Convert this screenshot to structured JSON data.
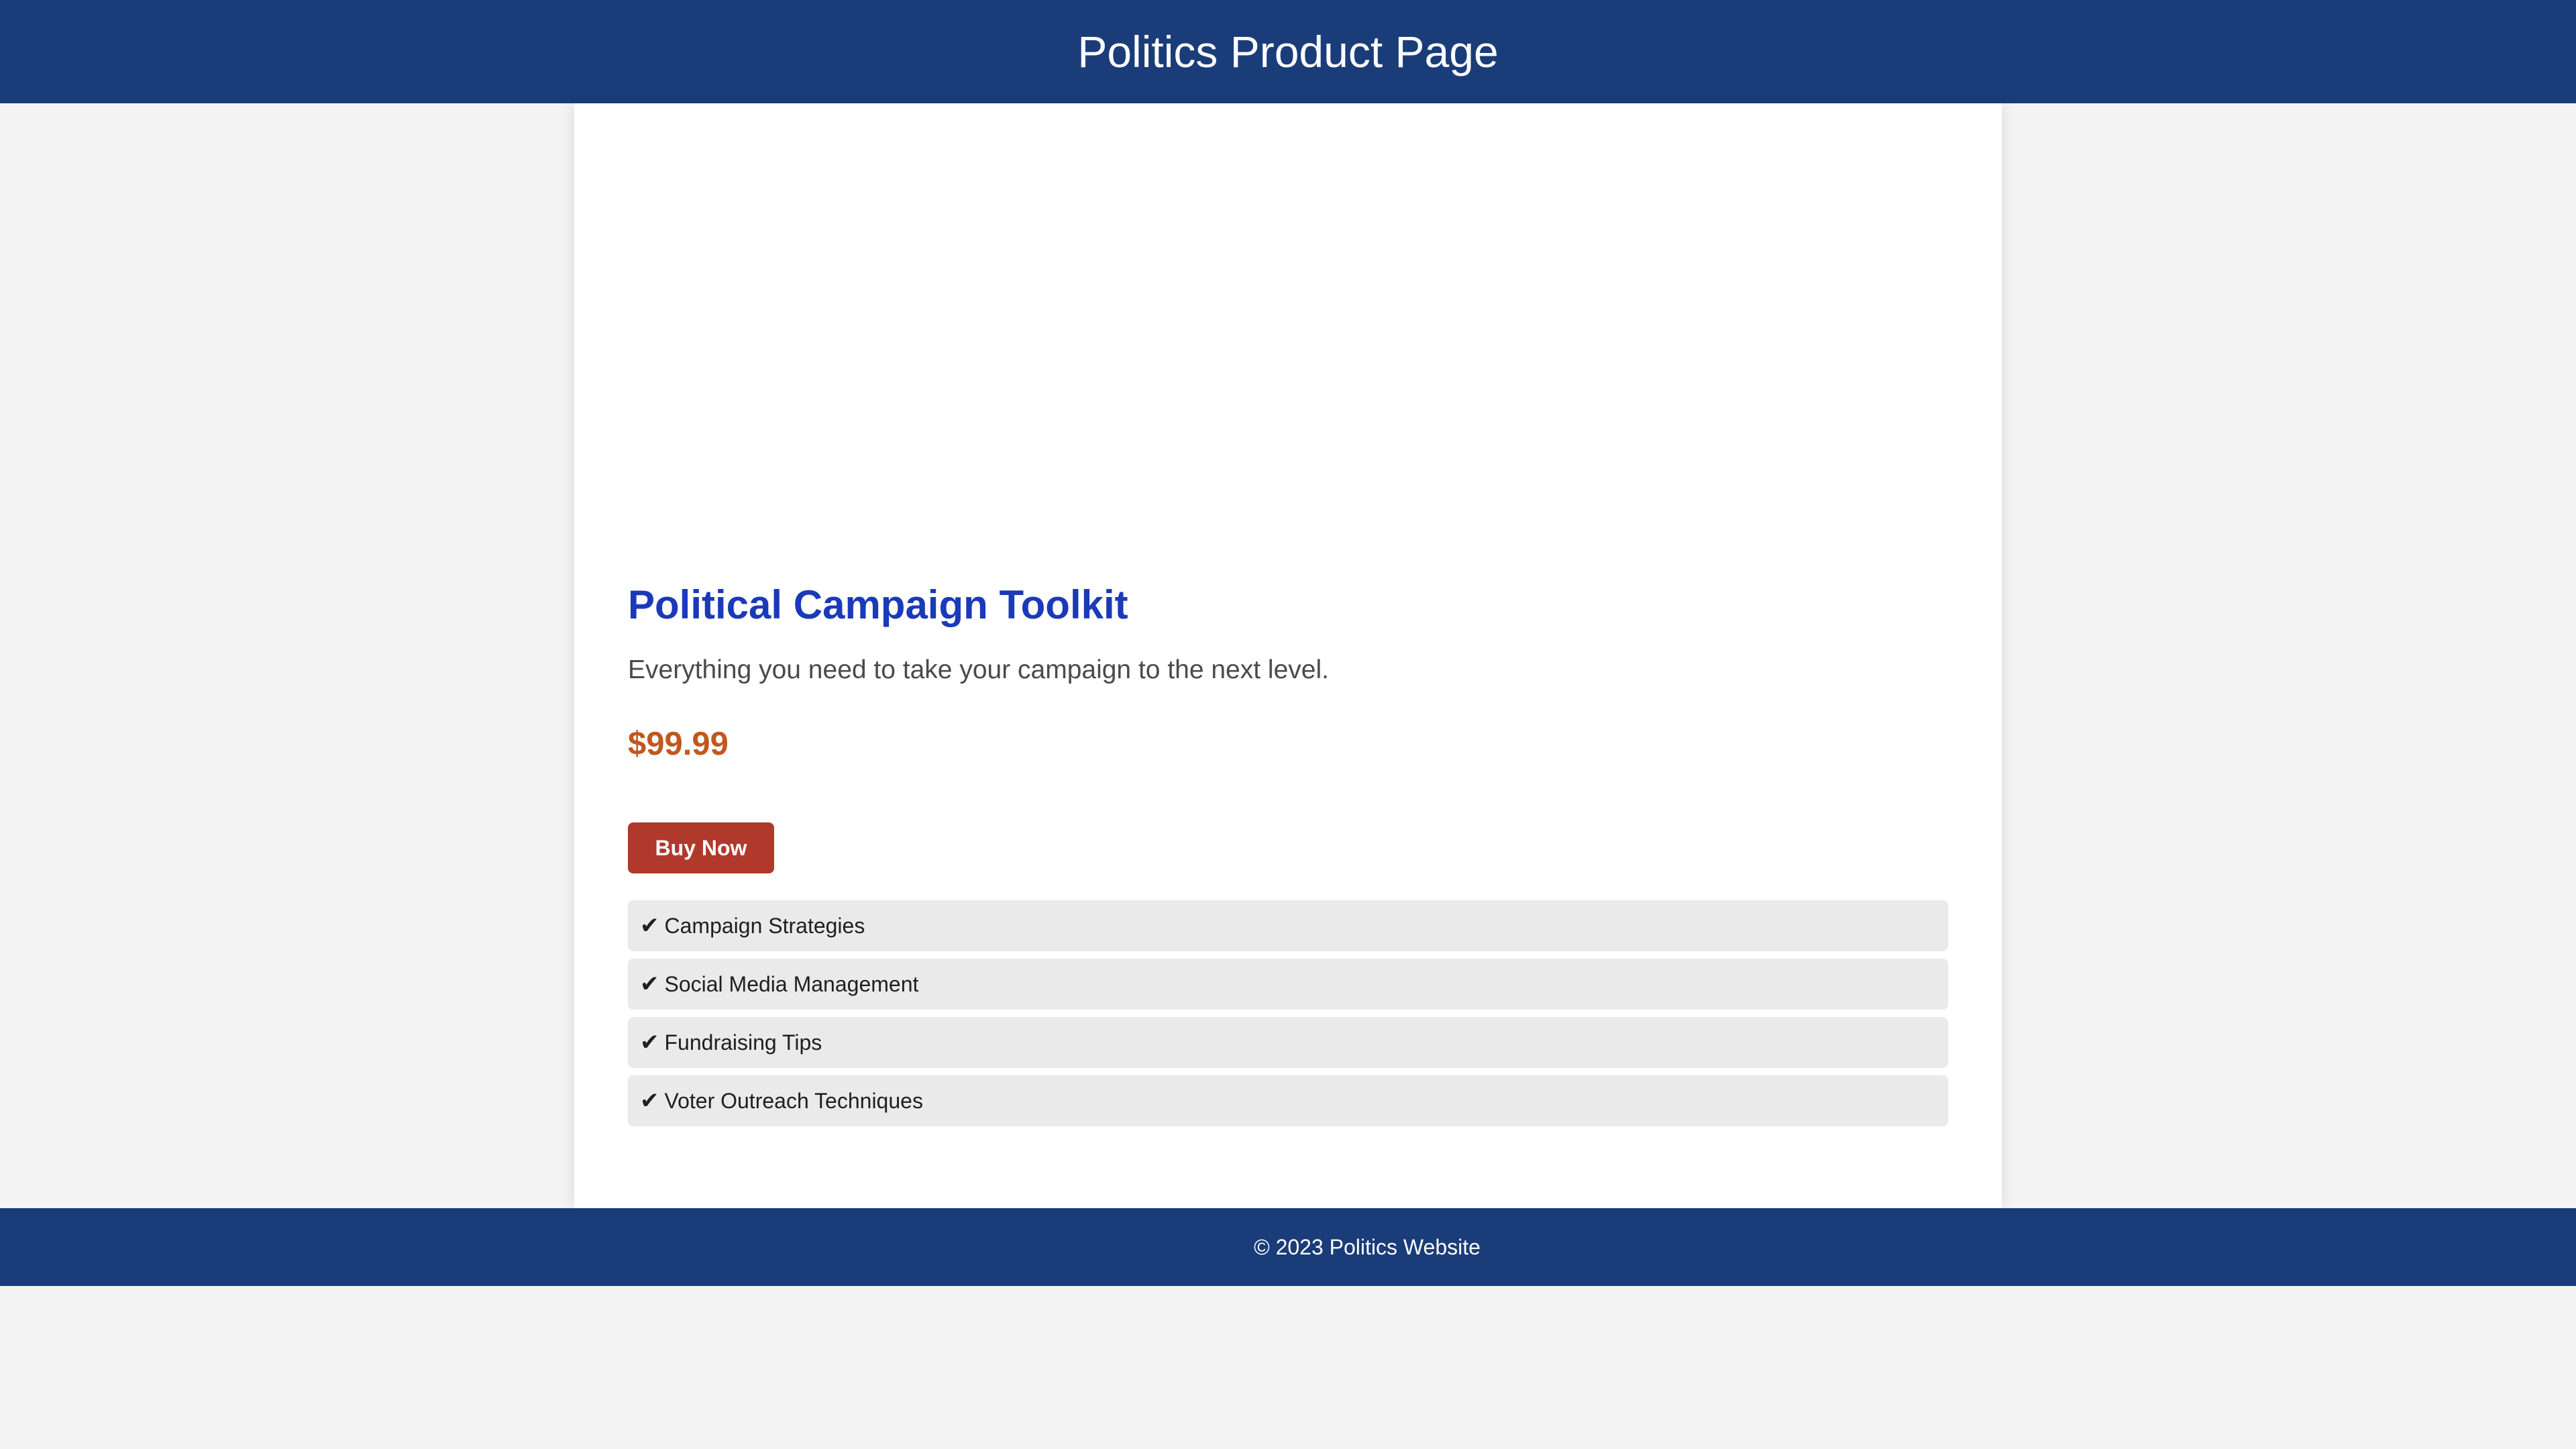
{
  "header": {
    "title": "Politics Product Page"
  },
  "product": {
    "title": "Political Campaign Toolkit",
    "description": "Everything you need to take your campaign to the next level.",
    "price": "$99.99",
    "buy_label": "Buy Now",
    "features": [
      {
        "icon": "check-icon",
        "glyph": "✔",
        "label": "Campaign Strategies"
      },
      {
        "icon": "check-icon",
        "glyph": "✔",
        "label": "Social Media Management"
      },
      {
        "icon": "check-icon",
        "glyph": "✔",
        "label": "Fundraising Tips"
      },
      {
        "icon": "check-icon",
        "glyph": "✔",
        "label": "Voter Outreach Techniques"
      }
    ]
  },
  "footer": {
    "text": "© 2023 Politics Website"
  },
  "colors": {
    "brand": "#1a3d7a",
    "title": "#1a3ab8",
    "price": "#c0581e",
    "button": "#b0392c",
    "feature_bg": "#eaeaea",
    "page_bg": "#f4f4f4"
  }
}
